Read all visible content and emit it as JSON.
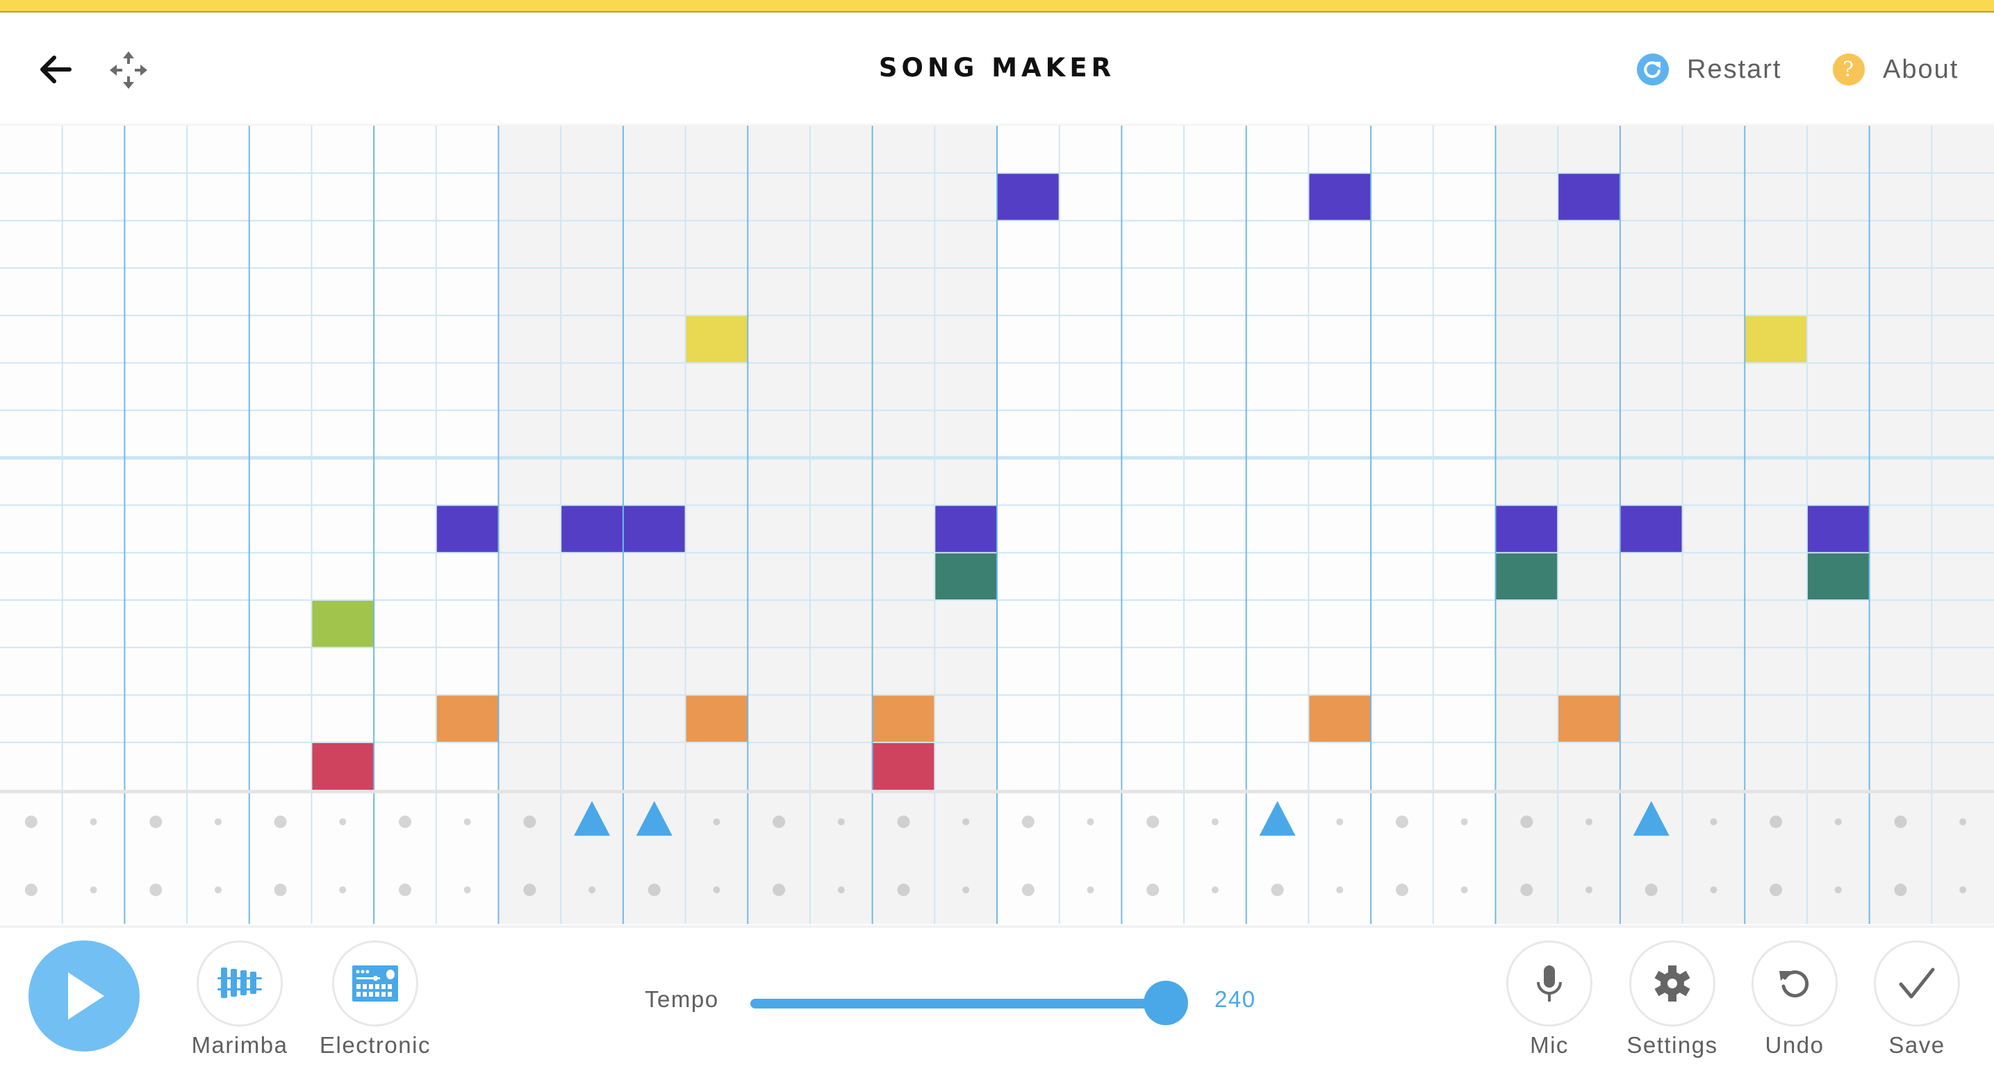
{
  "header": {
    "title": "SONG MAKER",
    "restart_label": "Restart",
    "about_label": "About",
    "icons": {
      "back": "arrow-left-icon",
      "move": "move-arrows-icon",
      "restart": "refresh-icon",
      "about": "question-icon"
    }
  },
  "colors": {
    "top_bar": "#fbd94f",
    "accent_blue": "#4aa8e8",
    "play_button": "#72bff3",
    "restart_icon": "#5db3ef",
    "about_icon": "#f7c455",
    "grid_line_major": "#72b9ea",
    "grid_line_minor": "#cfe6f6",
    "shaded_bar": "#f3f3f3"
  },
  "grid": {
    "columns": 32,
    "melody_rows": 14,
    "octave_divider_after_row": 6,
    "beats_per_bar": 4,
    "subdivisions_per_beat": 2,
    "shaded_bars": [
      1,
      3
    ],
    "notes": [
      {
        "row": 1,
        "col": 16,
        "color": "#543ec6"
      },
      {
        "row": 1,
        "col": 21,
        "color": "#543ec6"
      },
      {
        "row": 1,
        "col": 25,
        "color": "#543ec6"
      },
      {
        "row": 4,
        "col": 11,
        "color": "#e8d852"
      },
      {
        "row": 4,
        "col": 28,
        "color": "#e8d852"
      },
      {
        "row": 8,
        "col": 7,
        "color": "#543ec6"
      },
      {
        "row": 8,
        "col": 9,
        "color": "#543ec6"
      },
      {
        "row": 8,
        "col": 10,
        "color": "#543ec6"
      },
      {
        "row": 8,
        "col": 15,
        "color": "#543ec6"
      },
      {
        "row": 8,
        "col": 24,
        "color": "#543ec6"
      },
      {
        "row": 8,
        "col": 26,
        "color": "#543ec6"
      },
      {
        "row": 8,
        "col": 29,
        "color": "#543ec6"
      },
      {
        "row": 9,
        "col": 15,
        "color": "#3b8070"
      },
      {
        "row": 9,
        "col": 24,
        "color": "#3b8070"
      },
      {
        "row": 9,
        "col": 29,
        "color": "#3b8070"
      },
      {
        "row": 10,
        "col": 5,
        "color": "#a1c44c"
      },
      {
        "row": 12,
        "col": 7,
        "color": "#e99751"
      },
      {
        "row": 12,
        "col": 11,
        "color": "#e99751"
      },
      {
        "row": 12,
        "col": 14,
        "color": "#e99751"
      },
      {
        "row": 12,
        "col": 21,
        "color": "#e99751"
      },
      {
        "row": 12,
        "col": 25,
        "color": "#e99751"
      },
      {
        "row": 13,
        "col": 5,
        "color": "#d0435e"
      },
      {
        "row": 13,
        "col": 14,
        "color": "#d0435e"
      }
    ],
    "percussion": {
      "rows": 2,
      "hits": [
        {
          "row": 0,
          "col": 9,
          "shape": "triangle"
        },
        {
          "row": 0,
          "col": 10,
          "shape": "triangle"
        },
        {
          "row": 0,
          "col": 20,
          "shape": "triangle"
        },
        {
          "row": 0,
          "col": 26,
          "shape": "triangle"
        }
      ],
      "hit_color": "#4aa8e8",
      "empty_dot_color": "#d5d5d5"
    }
  },
  "footer": {
    "play_label": "Play",
    "instruments": [
      {
        "label": "Marimba",
        "icon": "marimba-icon"
      },
      {
        "label": "Electronic",
        "icon": "drum-machine-icon"
      }
    ],
    "tempo": {
      "label": "Tempo",
      "value": 240,
      "value_text": "240",
      "fill_fraction": 0.98
    },
    "tools": [
      {
        "label": "Mic",
        "icon": "microphone-icon"
      },
      {
        "label": "Settings",
        "icon": "gear-icon"
      },
      {
        "label": "Undo",
        "icon": "undo-icon"
      },
      {
        "label": "Save",
        "icon": "checkmark-icon"
      }
    ]
  }
}
